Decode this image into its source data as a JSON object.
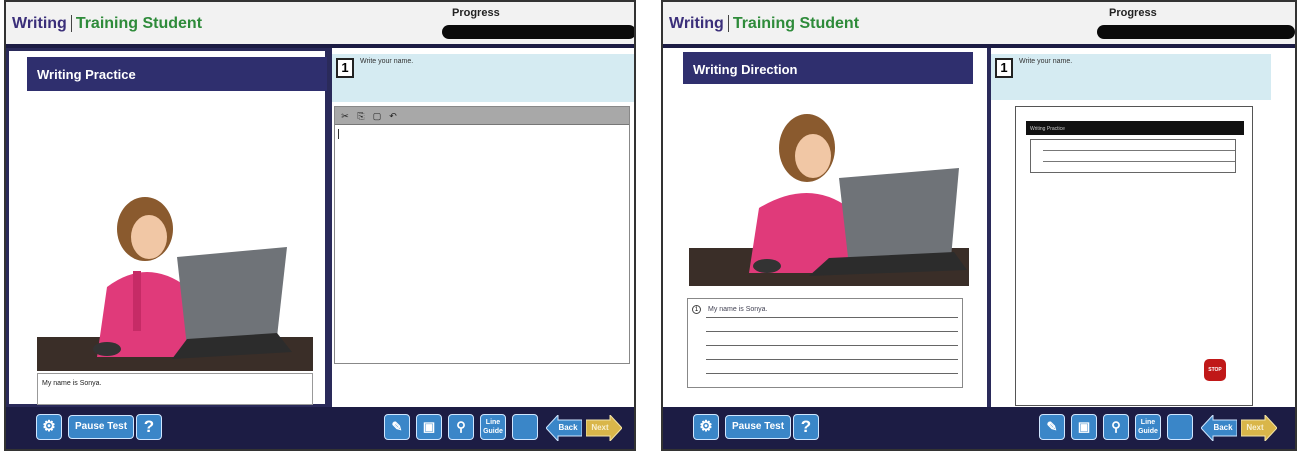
{
  "screens": [
    {
      "header": {
        "subject": "Writing",
        "student": "Training Student",
        "progress_label": "Progress"
      },
      "panel_title": "Writing Practice",
      "question": {
        "number": "1",
        "prompt": "Write your name."
      },
      "caption": "My name is Sonya.",
      "toolbar": {
        "pause_label": "Pause Test",
        "help_label": "?",
        "line_guide_label": "Line Guide",
        "back_label": "Back",
        "next_label": "Next"
      }
    },
    {
      "header": {
        "subject": "Writing",
        "student": "Training Student",
        "progress_label": "Progress"
      },
      "panel_title": "Writing Direction",
      "question": {
        "number": "1",
        "prompt": "Write your name."
      },
      "sample_answer": "My name is Sonya.",
      "mini_doc": {
        "title": "Writing Practice",
        "stop_label": "STOP"
      },
      "toolbar": {
        "pause_label": "Pause Test",
        "help_label": "?",
        "line_guide_label": "Line Guide",
        "back_label": "Back",
        "next_label": "Next"
      }
    }
  ],
  "colors": {
    "brand_purple": "#3b2f7a",
    "brand_green": "#2e8b3a",
    "nav_blue": "#2f2f6e",
    "button_blue": "#3a86c8",
    "next_gold": "#d9b64a"
  }
}
